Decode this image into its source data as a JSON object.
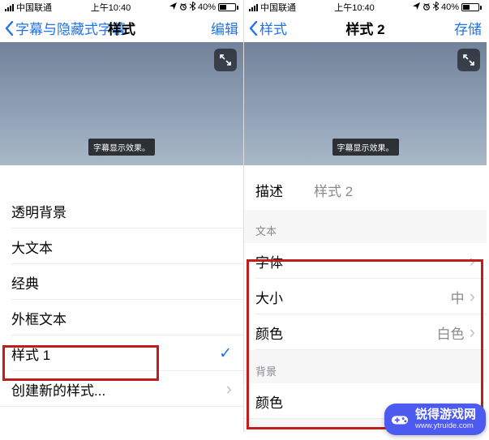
{
  "status": {
    "carrier": "中国联通",
    "time": "上午10:40",
    "battery_pct": "40%",
    "icons": [
      "location",
      "alarm",
      "bluetooth"
    ]
  },
  "left": {
    "nav": {
      "back": "字幕与隐藏式字幕",
      "title": "样式",
      "action": "编辑"
    },
    "preview": {
      "caption": "字幕显示效果。"
    },
    "styles": [
      {
        "label": "透明背景"
      },
      {
        "label": "大文本"
      },
      {
        "label": "经典"
      },
      {
        "label": "外框文本"
      },
      {
        "label": "样式 1",
        "checked": true
      },
      {
        "label": "创建新的样式...",
        "disclosure": true
      }
    ]
  },
  "right": {
    "nav": {
      "back": "样式",
      "title": "样式 2",
      "action": "存储"
    },
    "preview": {
      "caption": "字幕显示效果。"
    },
    "description": {
      "label": "描述",
      "value": "样式 2"
    },
    "sections": {
      "text": {
        "header": "文本",
        "rows": [
          {
            "label": "字体",
            "value": "",
            "disclosure": true
          },
          {
            "label": "大小",
            "value": "中",
            "disclosure": true
          },
          {
            "label": "颜色",
            "value": "白色",
            "disclosure": true
          }
        ]
      },
      "background": {
        "header": "背景",
        "rows": [
          {
            "label": "颜色"
          }
        ]
      }
    }
  },
  "watermark": {
    "name": "锐得游戏网",
    "url": "www.ytruide.com"
  }
}
